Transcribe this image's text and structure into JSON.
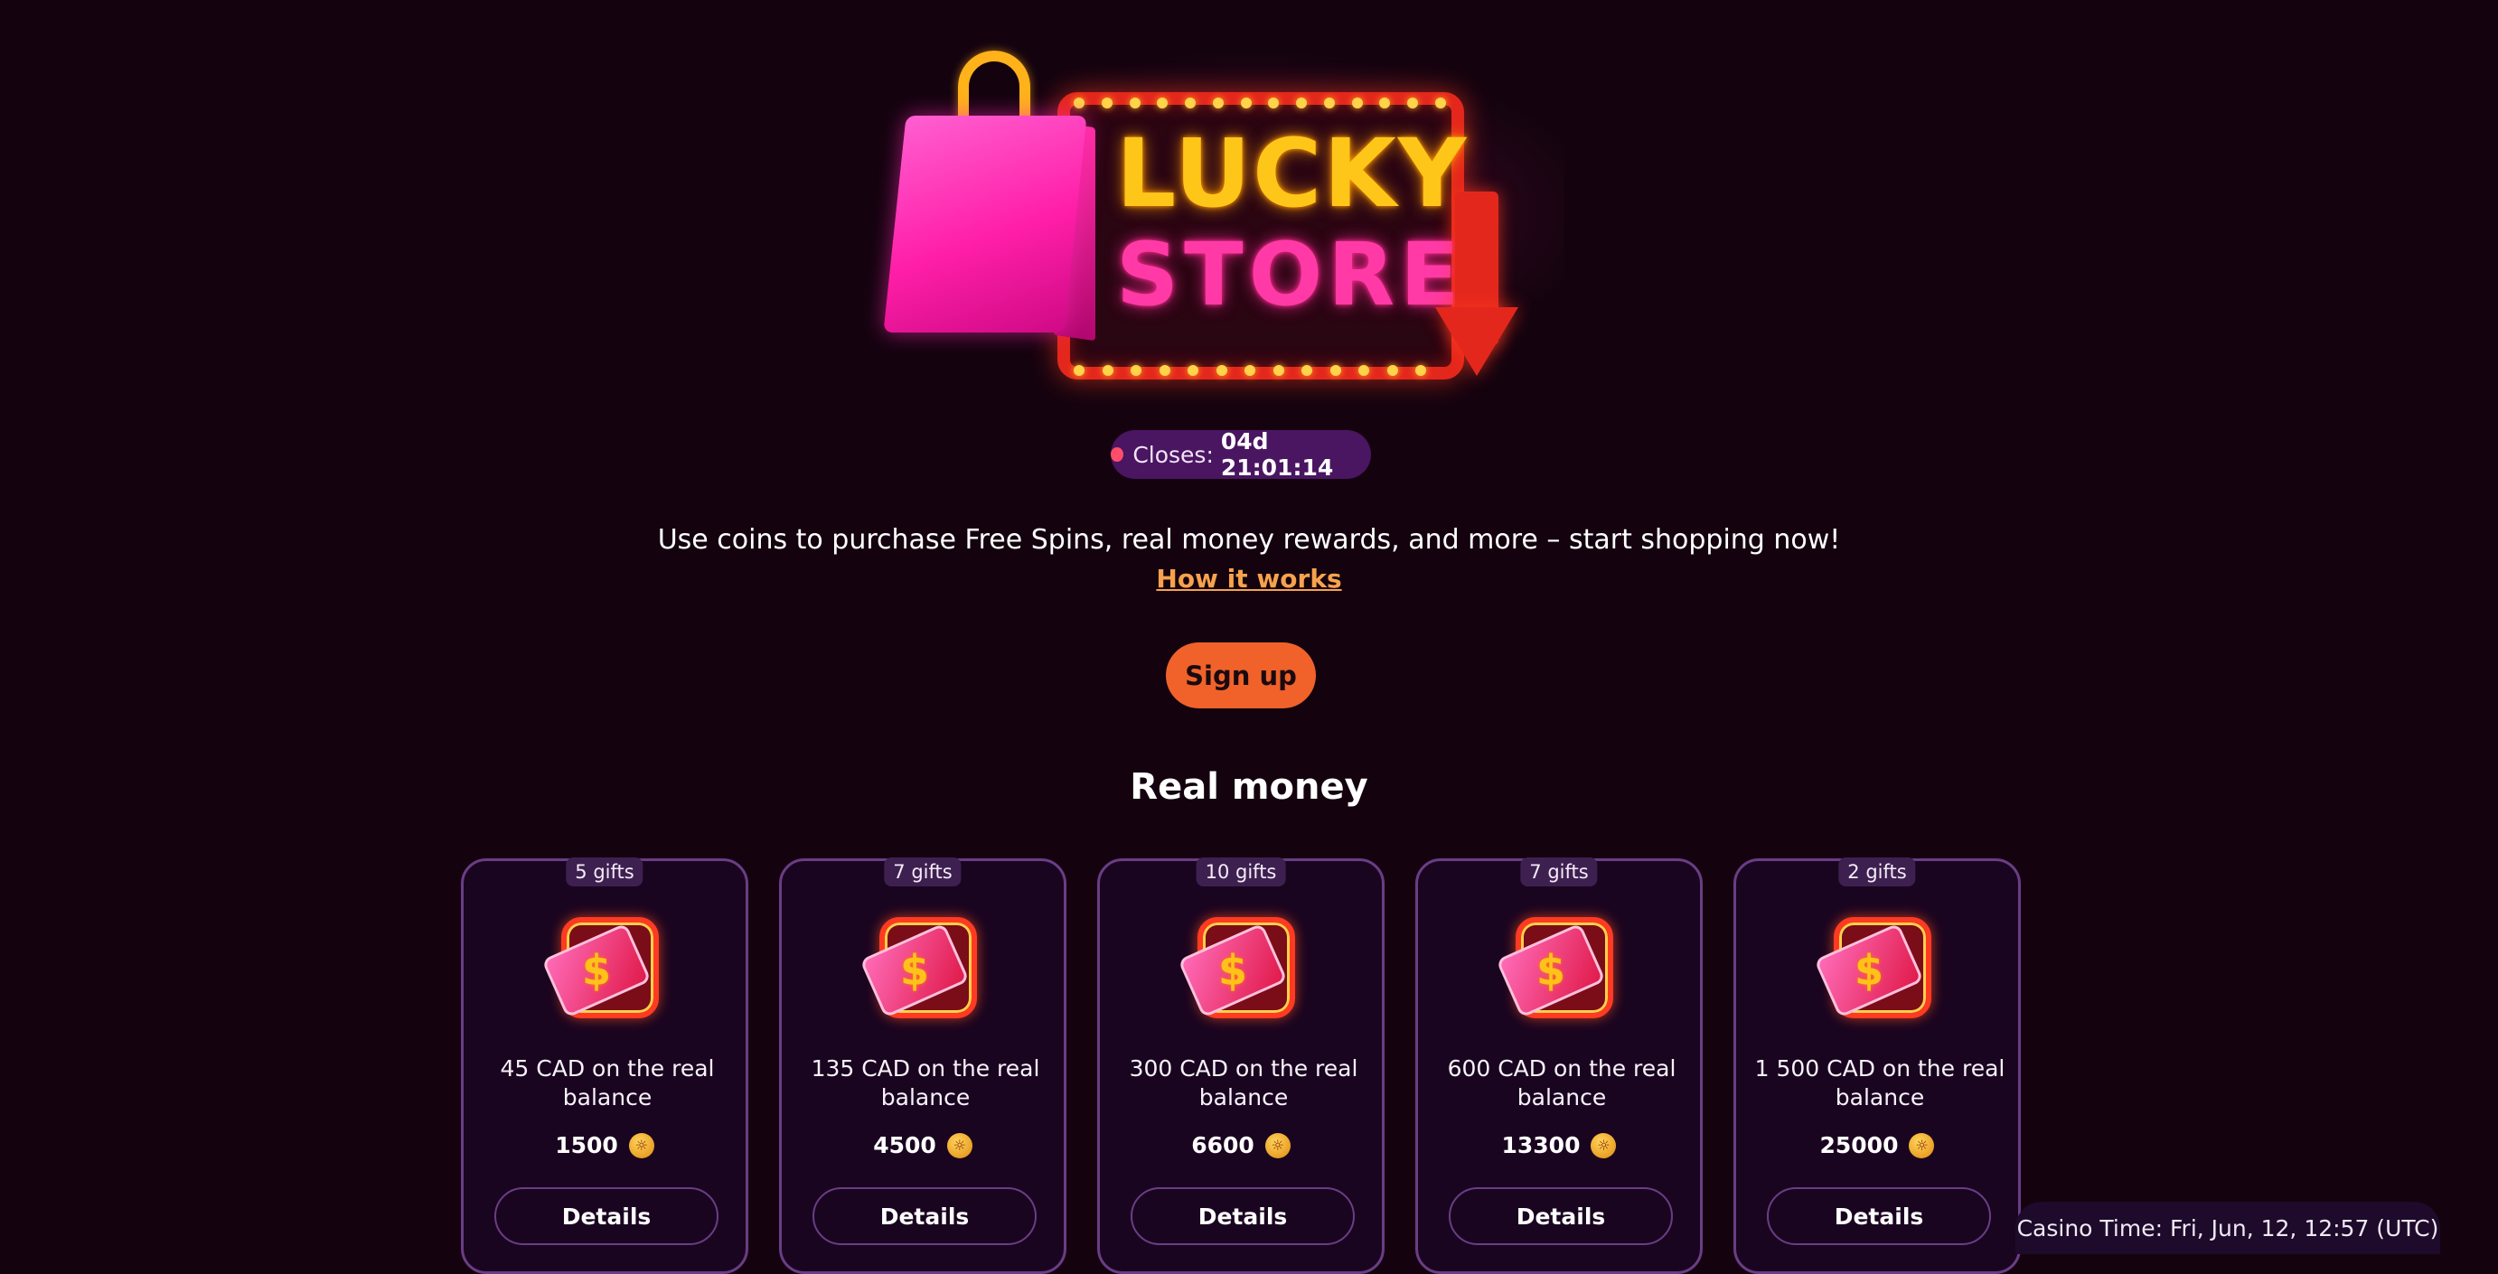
{
  "hero": {
    "line1": "LUCKY",
    "line2": "STORE"
  },
  "closes": {
    "label": "Closes:",
    "time": "04d 21:01:14"
  },
  "intro": {
    "description": "Use coins to purchase Free Spins, real money rewards, and more – start shopping now!",
    "how_it_works": "How it works"
  },
  "signup_label": "Sign up",
  "section_title": "Real money",
  "cards": [
    {
      "badge": "5 gifts",
      "title": "45 CAD on the real balance",
      "price": "1500",
      "details": "Details"
    },
    {
      "badge": "7 gifts",
      "title": "135 CAD on the real balance",
      "price": "4500",
      "details": "Details"
    },
    {
      "badge": "10 gifts",
      "title": "300 CAD on the real balance",
      "price": "6600",
      "details": "Details"
    },
    {
      "badge": "7 gifts",
      "title": "600 CAD on the real balance",
      "price": "13300",
      "details": "Details"
    },
    {
      "badge": "2 gifts",
      "title": "1 500 CAD on the real balance",
      "price": "25000",
      "details": "Details"
    }
  ],
  "icons": {
    "card_icon": "money-card-icon",
    "coin_icon": "coin-icon",
    "status_dot": "status-dot-icon"
  },
  "colors": {
    "background": "#14030f",
    "accent_orange": "#f0622a",
    "link_orange": "#f7a24c",
    "card_border": "#6a3d85",
    "pill_bg": "#4a1561"
  },
  "casino_time": "Casino Time: Fri, Jun, 12, 12:57 (UTC)"
}
